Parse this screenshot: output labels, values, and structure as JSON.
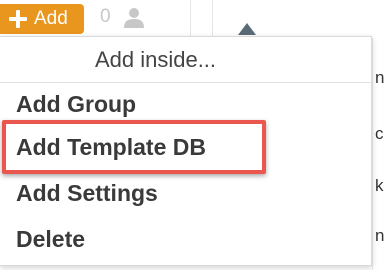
{
  "toolbar": {
    "add_label": "Add",
    "user_count": "0",
    "colors": {
      "add_button_bg": "#e8961e",
      "muted": "#c7c7c7"
    }
  },
  "menu": {
    "header": "Add inside...",
    "items": [
      {
        "label": "Add Group"
      },
      {
        "label": "Add Template DB",
        "highlighted": true
      },
      {
        "label": "Add Settings"
      },
      {
        "label": "Delete"
      }
    ],
    "highlight_color": "#e9574f"
  },
  "background_fragments": [
    "n",
    "c",
    "k",
    "n"
  ]
}
